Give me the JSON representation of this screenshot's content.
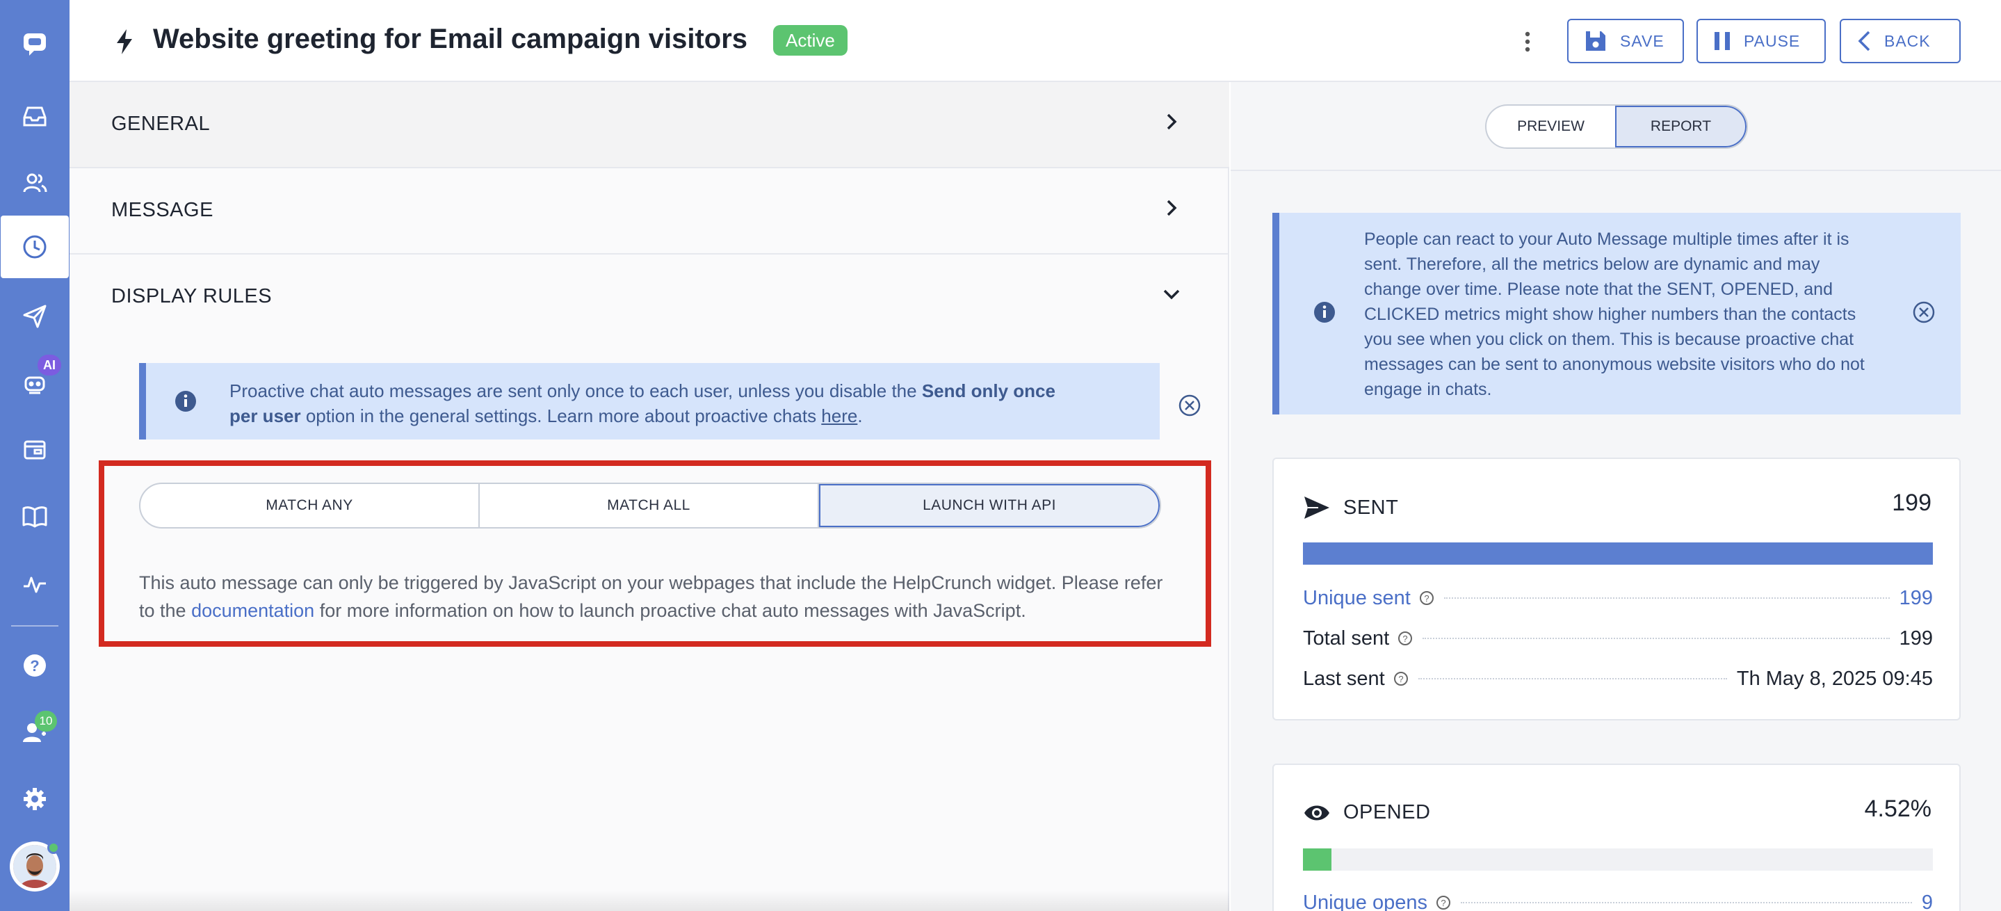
{
  "header": {
    "title": "Website greeting for Email campaign visitors",
    "status": "Active",
    "save_label": "SAVE",
    "pause_label": "PAUSE",
    "back_label": "BACK"
  },
  "rail": {
    "ai_badge": "AI",
    "people_badge": "10",
    "icons": [
      "chat-logo-icon",
      "inbox-icon",
      "contacts-icon",
      "auto-messages-icon",
      "send-icon",
      "ai-bot-icon",
      "wallet-icon",
      "knowledge-base-icon",
      "activity-icon",
      "help-icon",
      "team-icon",
      "settings-icon"
    ]
  },
  "sections": {
    "general": "GENERAL",
    "message": "MESSAGE",
    "display_rules": "DISPLAY RULES"
  },
  "notice": {
    "part1": "Proactive chat auto messages are sent only once to each user, unless you disable the ",
    "bold": "Send only once per user",
    "part2": " option in the general settings. Learn more about proactive chats ",
    "link": "here",
    "part3": "."
  },
  "match": {
    "options": [
      "MATCH ANY",
      "MATCH ALL",
      "LAUNCH WITH API"
    ],
    "selected": "LAUNCH WITH API"
  },
  "api_text": {
    "part1": "This auto message can only be triggered by JavaScript on your webpages that include the HelpCrunch widget. Please refer to the ",
    "link": "documentation",
    "part2": " for more information on how to launch proactive chat auto messages with JavaScript."
  },
  "right": {
    "tabs": [
      "PREVIEW",
      "REPORT"
    ],
    "selected_tab": "REPORT",
    "notice": "People can react to your Auto Message multiple times after it is sent. Therefore, all the metrics below are dynamic and may change over time. Please note that the SENT, OPENED, and CLICKED metrics might show higher numbers than the contacts you see when you click on them. This is because proactive chat messages can be sent to anonymous website visitors who do not engage in chats."
  },
  "sent": {
    "title": "SENT",
    "value": "199",
    "progress": 1.0,
    "rows": [
      {
        "label": "Unique sent",
        "value": "199"
      },
      {
        "label": "Total sent",
        "value": "199"
      },
      {
        "label": "Last sent",
        "value": "Th May 8, 2025 09:45"
      }
    ]
  },
  "opened": {
    "title": "OPENED",
    "value": "4.52%",
    "progress": 0.0452,
    "rows": [
      {
        "label": "Unique opens",
        "value": "9"
      }
    ]
  },
  "colors": {
    "rail": "#5c7fd0",
    "accent": "#4a6fc7",
    "active_green": "#5cc470",
    "highlight_red": "#d32a20"
  }
}
